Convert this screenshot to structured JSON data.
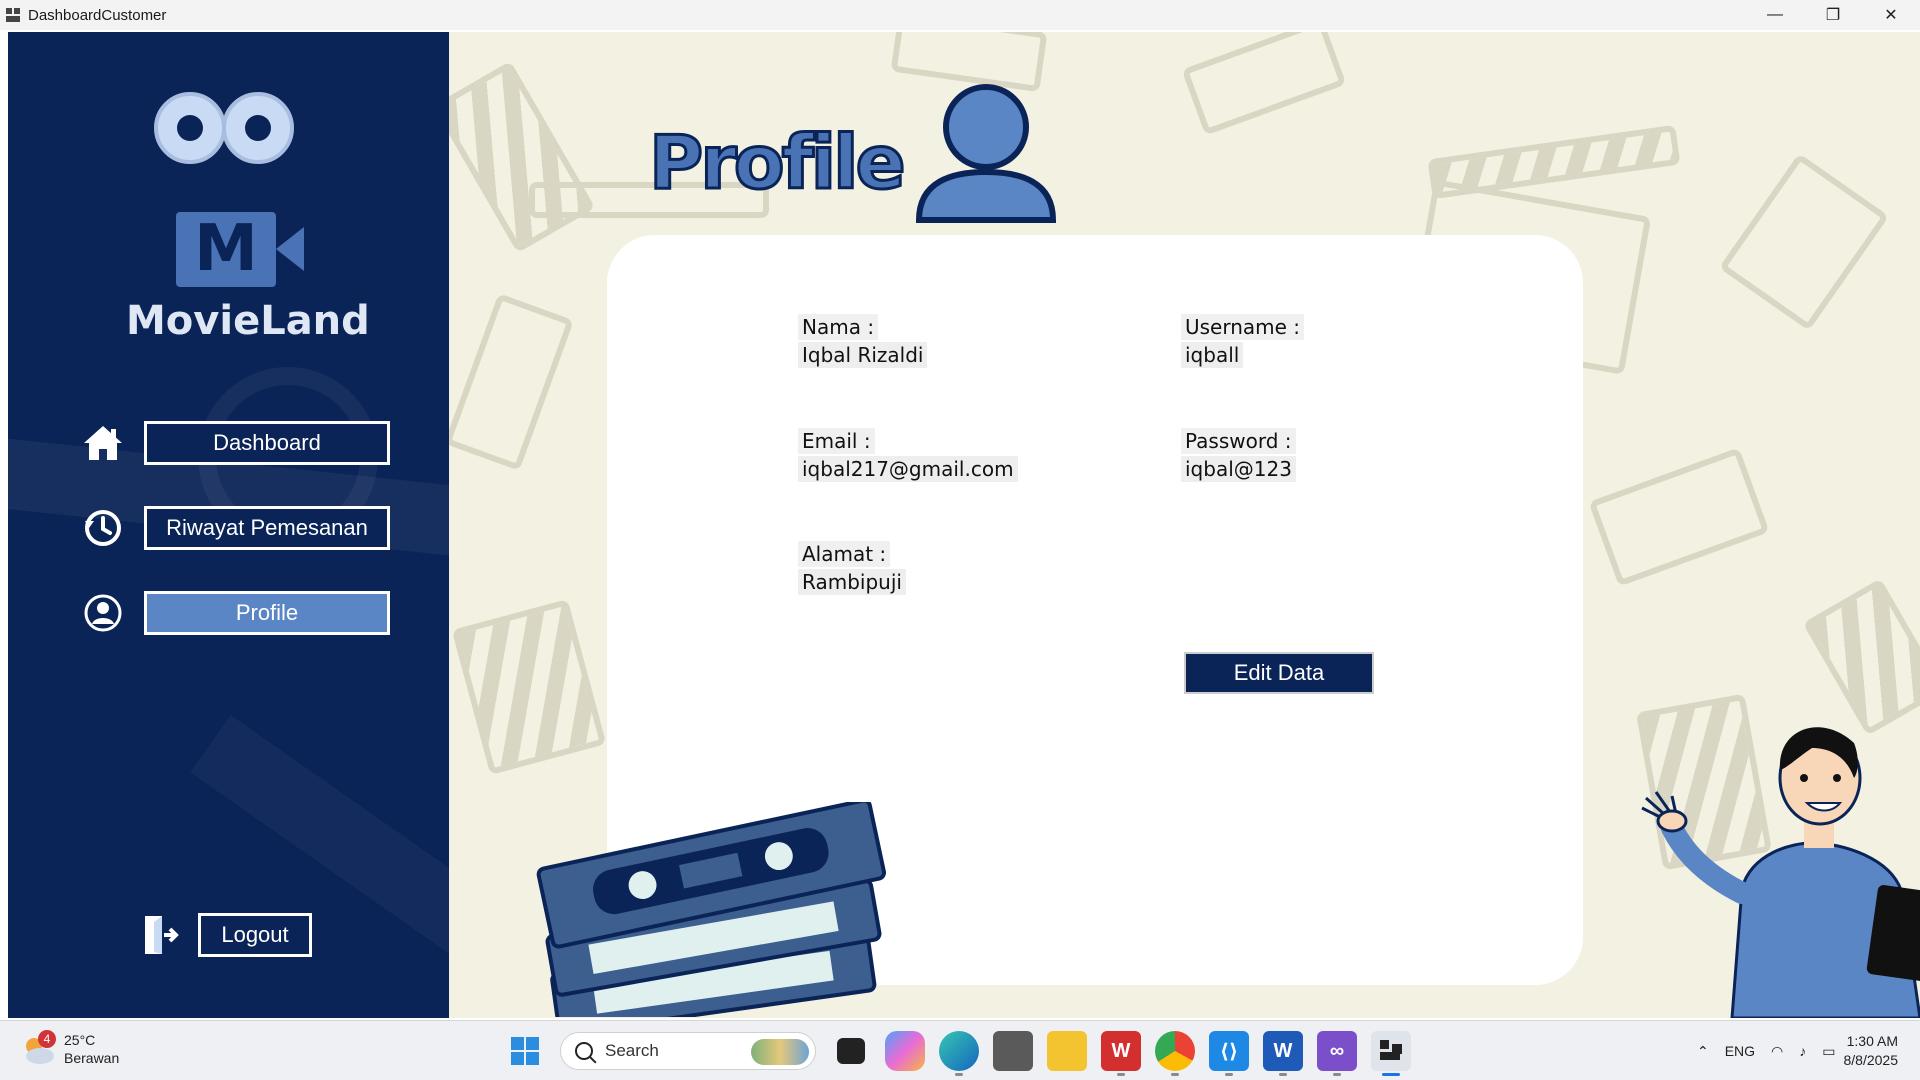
{
  "window": {
    "title": "DashboardCustomer",
    "controls": [
      "—",
      "❐",
      "✕"
    ]
  },
  "sidebar": {
    "brand": "MovieLand",
    "nav": [
      {
        "label": "Dashboard",
        "icon": "home-icon",
        "active": false
      },
      {
        "label": "Riwayat Pemesanan",
        "icon": "history-icon",
        "active": false
      },
      {
        "label": "Profile",
        "icon": "user-circle-icon",
        "active": true
      }
    ],
    "logout_label": "Logout"
  },
  "main": {
    "heading": "Profile",
    "fields": {
      "nama_label": "Nama :",
      "nama_value": "Iqbal Rizaldi",
      "username_label": "Username :",
      "username_value": "iqball",
      "email_label": "Email :",
      "email_value": "iqbal217@gmail.com",
      "password_label": "Password :",
      "password_value": "iqbal@123",
      "alamat_label": "Alamat :",
      "alamat_value": "Rambipuji"
    },
    "edit_button": "Edit Data"
  },
  "taskbar": {
    "weather_temp": "25°C",
    "weather_desc": "Berawan",
    "weather_badge": "4",
    "search_label": "Search",
    "language": "ENG",
    "time": "1:30 AM",
    "date": "8/8/2025"
  },
  "colors": {
    "sidebar_bg": "#0b2457",
    "accent": "#5b86c6",
    "main_bg": "#f3f1e2"
  }
}
